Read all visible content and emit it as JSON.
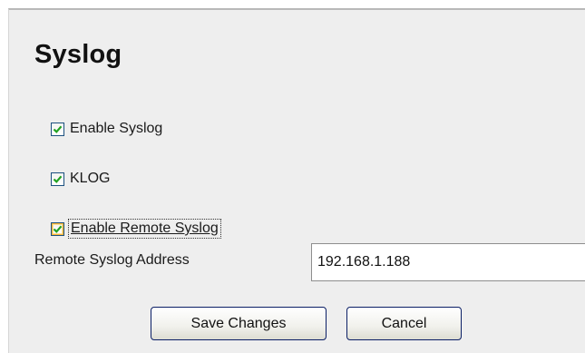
{
  "title": "Syslog",
  "options": [
    {
      "label": "Enable Syslog",
      "checked": true
    },
    {
      "label": "KLOG",
      "checked": true
    },
    {
      "label": "Enable Remote Syslog",
      "checked": true,
      "focused": true
    }
  ],
  "remote_address": {
    "label": "Remote Syslog Address",
    "value": "192.168.1.188"
  },
  "buttons": {
    "save_label": "Save Changes",
    "cancel_label": "Cancel"
  },
  "colors": {
    "check_mark": "#21a121",
    "panel_background": "#eeeeee",
    "button_border": "#0b1f66"
  }
}
